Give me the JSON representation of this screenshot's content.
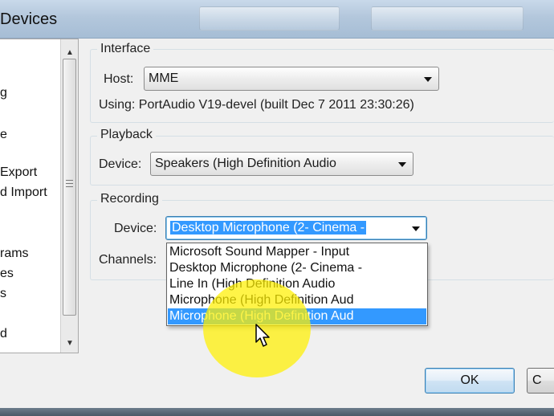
{
  "window": {
    "title": "Devices"
  },
  "categories": {
    "items": [
      "g",
      "e",
      "Export",
      "d Import",
      "rams",
      "es",
      "s",
      "d"
    ]
  },
  "interface": {
    "group_label": "Interface",
    "host_label": "Host:",
    "host_value": "MME",
    "using_text": "Using: PortAudio V19-devel (built Dec  7 2011 23:30:26)"
  },
  "playback": {
    "group_label": "Playback",
    "device_label": "Device:",
    "device_value": "Speakers (High Definition Audio"
  },
  "recording": {
    "group_label": "Recording",
    "device_label": "Device:",
    "device_value": "Desktop Microphone (2- Cinema -",
    "channels_label": "Channels:",
    "options": [
      "Microsoft Sound Mapper - Input",
      "Desktop Microphone (2- Cinema -",
      "Line In (High Definition Audio",
      "Microphone (High Definition Aud",
      "Microphone (High Definition Aud"
    ],
    "highlighted_index": 4
  },
  "buttons": {
    "ok": "OK",
    "cancel": "C"
  },
  "colors": {
    "selection": "#3399ff",
    "highlight_circle": "#fff000",
    "titlebar": "#b3c7dc"
  }
}
